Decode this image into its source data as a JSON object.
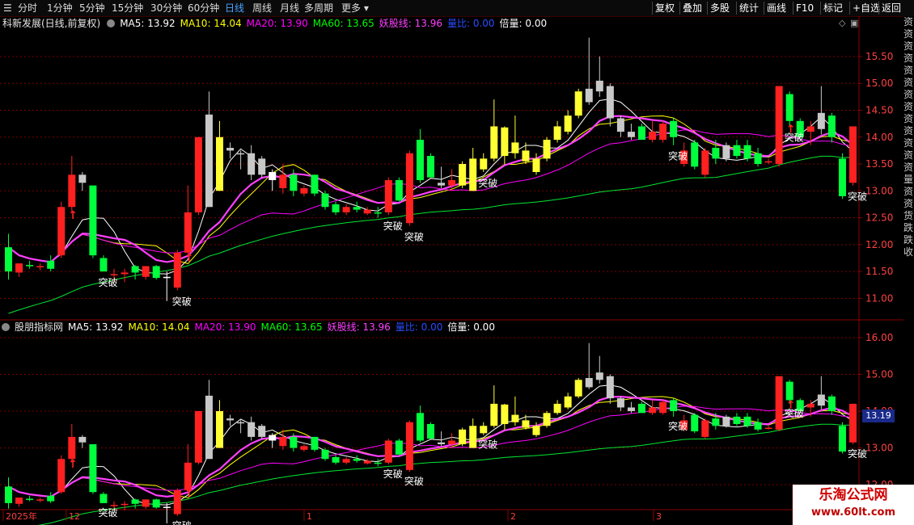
{
  "toolbar": {
    "periods": [
      "分时",
      "1分钟",
      "5分钟",
      "15分钟",
      "30分钟",
      "60分钟",
      "日线",
      "周线",
      "月线",
      "多周期",
      "更多"
    ],
    "active_period": "日线",
    "buttons": [
      "复权",
      "叠加",
      "多股",
      "统计",
      "画线",
      "F10",
      "标记",
      "+自选",
      "返回"
    ]
  },
  "main_panel": {
    "title": "科新发展(日线,前复权)",
    "indicators": [
      {
        "label": "MA5: 13.92",
        "color": "#ffffff"
      },
      {
        "label": "MA10: 14.04",
        "color": "#ffff00"
      },
      {
        "label": "MA20: 13.90",
        "color": "#ff00ff"
      },
      {
        "label": "MA60: 13.65",
        "color": "#00ff00"
      },
      {
        "label": "妖股线: 13.96",
        "color": "#ff40ff"
      },
      {
        "label": "量比: 0.00",
        "color": "#2a4cff"
      },
      {
        "label": "倍量: 0.00",
        "color": "#ffffff"
      }
    ]
  },
  "sub_panel": {
    "title": "股朋指标网",
    "indicators": [
      {
        "label": "MA5: 13.92",
        "color": "#ffffff"
      },
      {
        "label": "MA10: 14.04",
        "color": "#ffff00"
      },
      {
        "label": "MA20: 13.90",
        "color": "#ff00ff"
      },
      {
        "label": "MA60: 13.65",
        "color": "#00ff00"
      },
      {
        "label": "妖股线: 13.96",
        "color": "#ff40ff"
      },
      {
        "label": "量比: 0.00",
        "color": "#2a4cff"
      },
      {
        "label": "倍量: 0.00",
        "color": "#ffffff"
      }
    ],
    "current_price": "13.19"
  },
  "side_text": [
    "资",
    "资",
    "资",
    "资",
    "资",
    "资",
    "资",
    "资",
    "资",
    "资",
    "资",
    "资",
    "资",
    "量",
    "资",
    "资",
    "货",
    "跌",
    "跌",
    "收"
  ],
  "date_axis": [
    "2025年",
    "12",
    "1",
    "2",
    "3"
  ],
  "watermark": {
    "line1": "乐淘公式网",
    "line2": "www.60lt.com"
  },
  "signal_label": "突破",
  "colors": {
    "up": "#ff2020",
    "down": "#00ff3c",
    "yellow_up": "#ffff33",
    "gray": "#c8c8c8",
    "grid": "#7a0000",
    "axis_text": "#ff4040"
  },
  "chart_data": {
    "type": "candlestick",
    "main_y_ticks": [
      15.5,
      15.0,
      14.5,
      14.0,
      13.5,
      13.0,
      12.5,
      12.0,
      11.5,
      11.0
    ],
    "main_ylim": [
      10.6,
      15.98
    ],
    "sub_y_ticks": [
      16.0,
      15.0,
      14.0,
      13.0,
      12.0
    ],
    "sub_ylim": [
      11.3,
      16.35
    ],
    "candles": [
      {
        "o": 11.5,
        "h": 12.2,
        "l": 11.35,
        "c": 11.95,
        "k": "d"
      },
      {
        "o": 11.48,
        "h": 11.65,
        "l": 11.4,
        "c": 11.65,
        "k": "u"
      },
      {
        "o": 11.6,
        "h": 11.7,
        "l": 11.55,
        "c": 11.62,
        "k": "d"
      },
      {
        "o": 11.58,
        "h": 11.65,
        "l": 11.52,
        "c": 11.6,
        "k": "u"
      },
      {
        "o": 11.7,
        "h": 11.8,
        "l": 11.5,
        "c": 11.55,
        "k": "d"
      },
      {
        "o": 11.8,
        "h": 12.8,
        "l": 11.75,
        "c": 12.7,
        "k": "u"
      },
      {
        "o": 12.7,
        "h": 13.65,
        "l": 12.6,
        "c": 13.3,
        "k": "u"
      },
      {
        "o": 13.3,
        "h": 13.35,
        "l": 13.0,
        "c": 13.15,
        "k": "g"
      },
      {
        "o": 13.1,
        "h": 13.1,
        "l": 11.75,
        "c": 11.8,
        "k": "d"
      },
      {
        "o": 11.75,
        "h": 11.8,
        "l": 11.5,
        "c": 11.5,
        "k": "d"
      },
      {
        "o": 11.45,
        "h": 11.55,
        "l": 11.3,
        "c": 11.45,
        "k": "u"
      },
      {
        "o": 11.45,
        "h": 11.55,
        "l": 11.3,
        "c": 11.48,
        "k": "u"
      },
      {
        "o": 11.48,
        "h": 11.62,
        "l": 11.35,
        "c": 11.6,
        "k": "d"
      },
      {
        "o": 11.6,
        "h": 11.6,
        "l": 11.35,
        "c": 11.4,
        "k": "u"
      },
      {
        "o": 11.6,
        "h": 11.62,
        "l": 11.35,
        "c": 11.38,
        "k": "d"
      },
      {
        "o": 11.4,
        "h": 11.5,
        "l": 10.95,
        "c": 11.4,
        "k": "w"
      },
      {
        "o": 11.2,
        "h": 11.9,
        "l": 11.15,
        "c": 11.85,
        "k": "u"
      },
      {
        "o": 11.85,
        "h": 13.1,
        "l": 11.8,
        "c": 12.6,
        "k": "u"
      },
      {
        "o": 12.6,
        "h": 14.0,
        "l": 12.55,
        "c": 14.0,
        "k": "u"
      },
      {
        "o": 12.7,
        "h": 14.85,
        "l": 12.7,
        "c": 14.42,
        "k": "g"
      },
      {
        "o": 14.0,
        "h": 14.3,
        "l": 13.0,
        "c": 13.0,
        "k": "y"
      },
      {
        "o": 13.75,
        "h": 13.9,
        "l": 13.6,
        "c": 13.8,
        "k": "g"
      },
      {
        "o": 13.7,
        "h": 13.75,
        "l": 13.4,
        "c": 13.68,
        "k": "g"
      },
      {
        "o": 13.7,
        "h": 13.85,
        "l": 13.2,
        "c": 13.3,
        "k": "g"
      },
      {
        "o": 13.6,
        "h": 13.65,
        "l": 13.25,
        "c": 13.3,
        "k": "g"
      },
      {
        "o": 13.2,
        "h": 13.4,
        "l": 13.0,
        "c": 13.35,
        "k": "w"
      },
      {
        "o": 13.3,
        "h": 13.5,
        "l": 12.95,
        "c": 13.05,
        "k": "u"
      },
      {
        "o": 13.3,
        "h": 13.4,
        "l": 12.9,
        "c": 13.0,
        "k": "d"
      },
      {
        "o": 13.05,
        "h": 13.1,
        "l": 12.9,
        "c": 12.95,
        "k": "u"
      },
      {
        "o": 13.3,
        "h": 13.3,
        "l": 12.9,
        "c": 12.95,
        "k": "d"
      },
      {
        "o": 12.95,
        "h": 13.0,
        "l": 12.65,
        "c": 12.7,
        "k": "d"
      },
      {
        "o": 12.75,
        "h": 12.8,
        "l": 12.55,
        "c": 12.6,
        "k": "d"
      },
      {
        "o": 12.6,
        "h": 12.75,
        "l": 12.55,
        "c": 12.7,
        "k": "u"
      },
      {
        "o": 12.7,
        "h": 12.8,
        "l": 12.6,
        "c": 12.65,
        "k": "d"
      },
      {
        "o": 12.65,
        "h": 12.7,
        "l": 12.55,
        "c": 12.58,
        "k": "u"
      },
      {
        "o": 12.6,
        "h": 12.7,
        "l": 12.5,
        "c": 12.6,
        "k": "d"
      },
      {
        "o": 12.6,
        "h": 13.25,
        "l": 12.55,
        "c": 13.2,
        "k": "u"
      },
      {
        "o": 13.2,
        "h": 13.25,
        "l": 12.8,
        "c": 12.82,
        "k": "d"
      },
      {
        "o": 12.4,
        "h": 13.75,
        "l": 12.35,
        "c": 13.7,
        "k": "u"
      },
      {
        "o": 13.95,
        "h": 14.15,
        "l": 13.15,
        "c": 13.2,
        "k": "d"
      },
      {
        "o": 13.65,
        "h": 13.7,
        "l": 13.25,
        "c": 13.25,
        "k": "d"
      },
      {
        "o": 13.15,
        "h": 13.45,
        "l": 13.05,
        "c": 13.1,
        "k": "g"
      },
      {
        "o": 13.1,
        "h": 13.4,
        "l": 13.0,
        "c": 13.2,
        "k": "u"
      },
      {
        "o": 13.1,
        "h": 13.55,
        "l": 13.05,
        "c": 13.5,
        "k": "y"
      },
      {
        "o": 13.6,
        "h": 13.8,
        "l": 13.0,
        "c": 13.0,
        "k": "y"
      },
      {
        "o": 13.4,
        "h": 13.7,
        "l": 13.35,
        "c": 13.6,
        "k": "y"
      },
      {
        "o": 13.6,
        "h": 14.7,
        "l": 13.55,
        "c": 14.2,
        "k": "y"
      },
      {
        "o": 13.65,
        "h": 14.2,
        "l": 13.5,
        "c": 14.18,
        "k": "y"
      },
      {
        "o": 13.9,
        "h": 14.4,
        "l": 13.6,
        "c": 13.7,
        "k": "y"
      },
      {
        "o": 13.75,
        "h": 13.9,
        "l": 13.5,
        "c": 13.55,
        "k": "y"
      },
      {
        "o": 13.35,
        "h": 13.7,
        "l": 13.3,
        "c": 13.6,
        "k": "y"
      },
      {
        "o": 13.6,
        "h": 14.0,
        "l": 13.55,
        "c": 13.95,
        "k": "y"
      },
      {
        "o": 13.95,
        "h": 14.3,
        "l": 13.9,
        "c": 14.2,
        "k": "y"
      },
      {
        "o": 14.1,
        "h": 14.5,
        "l": 14.05,
        "c": 14.4,
        "k": "y"
      },
      {
        "o": 14.4,
        "h": 14.9,
        "l": 14.35,
        "c": 14.85,
        "k": "y"
      },
      {
        "o": 14.65,
        "h": 15.85,
        "l": 14.6,
        "c": 14.9,
        "k": "g"
      },
      {
        "o": 14.85,
        "h": 15.5,
        "l": 14.75,
        "c": 15.05,
        "k": "g"
      },
      {
        "o": 14.95,
        "h": 15.0,
        "l": 14.2,
        "c": 14.35,
        "k": "g"
      },
      {
        "o": 14.35,
        "h": 14.4,
        "l": 14.0,
        "c": 14.1,
        "k": "g"
      },
      {
        "o": 14.1,
        "h": 14.25,
        "l": 13.95,
        "c": 14.0,
        "k": "g"
      },
      {
        "o": 14.2,
        "h": 14.25,
        "l": 13.95,
        "c": 13.95,
        "k": "d"
      },
      {
        "o": 13.95,
        "h": 14.3,
        "l": 13.9,
        "c": 14.1,
        "k": "u"
      },
      {
        "o": 13.95,
        "h": 14.3,
        "l": 13.9,
        "c": 14.25,
        "k": "u"
      },
      {
        "o": 14.3,
        "h": 14.35,
        "l": 13.85,
        "c": 14.0,
        "k": "d"
      },
      {
        "o": 13.5,
        "h": 13.9,
        "l": 13.45,
        "c": 13.75,
        "k": "u"
      },
      {
        "o": 13.9,
        "h": 13.95,
        "l": 13.4,
        "c": 13.45,
        "k": "d"
      },
      {
        "o": 13.75,
        "h": 13.8,
        "l": 13.25,
        "c": 13.3,
        "k": "u"
      },
      {
        "o": 13.8,
        "h": 13.95,
        "l": 13.5,
        "c": 13.6,
        "k": "d"
      },
      {
        "o": 13.6,
        "h": 13.9,
        "l": 13.55,
        "c": 13.85,
        "k": "g"
      },
      {
        "o": 13.85,
        "h": 13.95,
        "l": 13.6,
        "c": 13.65,
        "k": "d"
      },
      {
        "o": 13.85,
        "h": 13.95,
        "l": 13.55,
        "c": 13.6,
        "k": "d"
      },
      {
        "o": 13.7,
        "h": 13.8,
        "l": 13.45,
        "c": 13.5,
        "k": "d"
      },
      {
        "o": 13.55,
        "h": 13.6,
        "l": 13.5,
        "c": 13.55,
        "k": "u"
      },
      {
        "o": 13.5,
        "h": 14.95,
        "l": 13.45,
        "c": 14.95,
        "k": "u"
      },
      {
        "o": 14.8,
        "h": 14.85,
        "l": 14.2,
        "c": 14.3,
        "k": "d"
      },
      {
        "o": 14.3,
        "h": 14.35,
        "l": 13.95,
        "c": 14.0,
        "k": "d"
      },
      {
        "o": 14.1,
        "h": 14.3,
        "l": 13.85,
        "c": 14.2,
        "k": "u"
      },
      {
        "o": 14.15,
        "h": 14.95,
        "l": 14.05,
        "c": 14.45,
        "k": "g"
      },
      {
        "o": 14.4,
        "h": 14.45,
        "l": 13.9,
        "c": 14.0,
        "k": "d"
      },
      {
        "o": 13.6,
        "h": 13.7,
        "l": 12.85,
        "c": 12.9,
        "k": "d"
      },
      {
        "o": 14.2,
        "h": 14.2,
        "l": 13.1,
        "c": 13.15,
        "k": "u"
      }
    ],
    "breakout_indices": [
      9,
      16,
      36,
      38,
      45,
      63,
      74,
      80
    ],
    "arrow_indices": [
      6,
      17,
      74
    ]
  }
}
